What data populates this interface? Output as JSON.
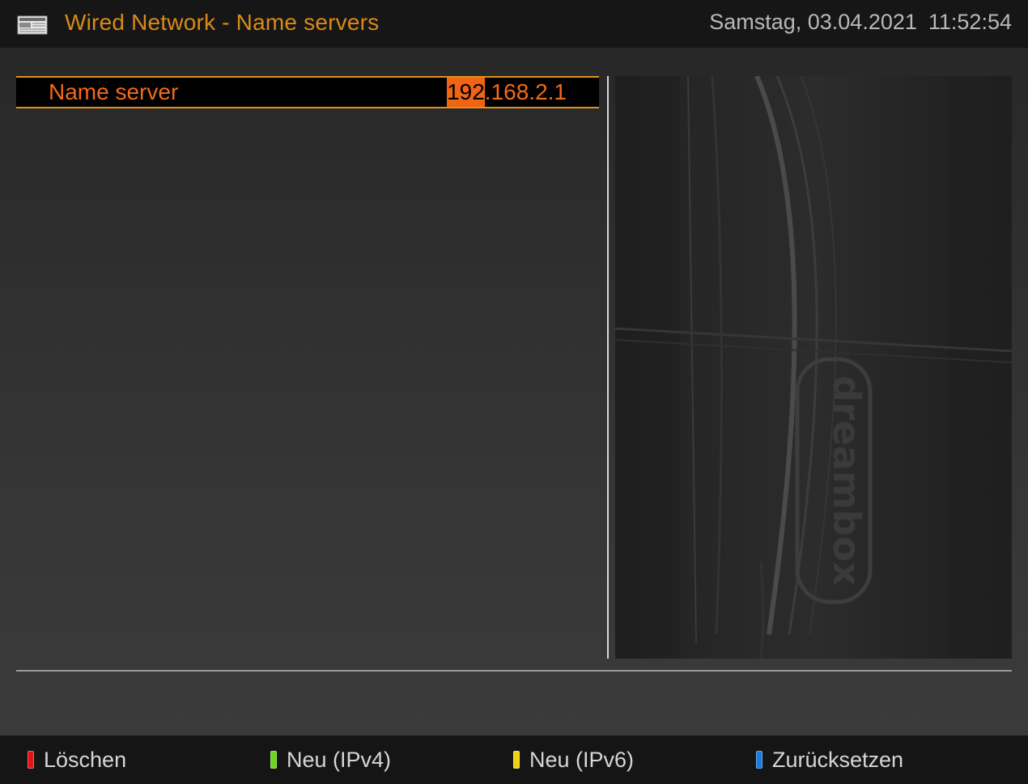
{
  "header": {
    "title": "Wired Network - Name servers",
    "date": "Samstag, 03.04.2021",
    "time": "11:52:54",
    "icon": "newspaper-icon"
  },
  "config_list": {
    "entries": [
      {
        "label": "Name server",
        "value_cursor_part": "192",
        "value_rest_part": ".168.2.1"
      }
    ]
  },
  "preview": {
    "description_icon": "dreambox-device-image"
  },
  "footer": {
    "buttons": [
      {
        "label": "Löschen",
        "color": "#e01414",
        "key": "red-key-icon"
      },
      {
        "label": "Neu (IPv4)",
        "color": "#6bd61a",
        "key": "green-key-icon"
      },
      {
        "label": "Neu (IPv6)",
        "color": "#f2d10c",
        "key": "yellow-key-icon"
      },
      {
        "label": "Zurücksetzen",
        "color": "#1a7ae0",
        "key": "blue-key-icon"
      }
    ]
  },
  "colors": {
    "accent_orange": "#d98a1a",
    "selection_text": "#f26a16",
    "cursor_bg": "#f06414"
  }
}
